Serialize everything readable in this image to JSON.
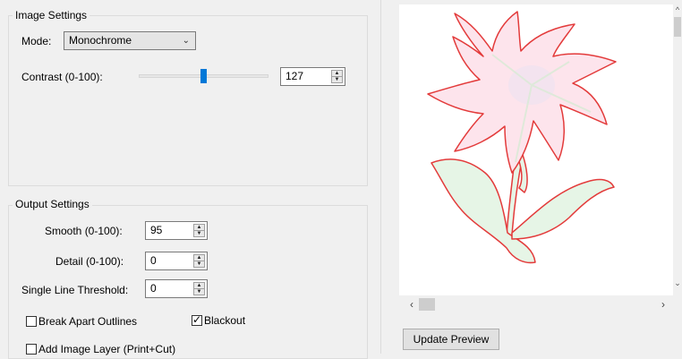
{
  "image_settings": {
    "title": "Image Settings",
    "mode_label": "Mode:",
    "mode_value": "Monochrome",
    "contrast_label": "Contrast (0-100):",
    "contrast_value": "127",
    "contrast_slider_fraction": 0.5
  },
  "output_settings": {
    "title": "Output Settings",
    "smooth_label": "Smooth (0-100):",
    "smooth_value": "95",
    "detail_label": "Detail (0-100):",
    "detail_value": "0",
    "threshold_label": "Single Line Threshold:",
    "threshold_value": "0",
    "break_apart_label": "Break Apart Outlines",
    "break_apart_checked": false,
    "blackout_label": "Blackout",
    "blackout_checked": true,
    "add_image_layer_label": "Add Image Layer (Print+Cut)",
    "add_image_layer_checked": false
  },
  "preview": {
    "update_button": "Update Preview",
    "fill_colors": {
      "petal": "#fde4ec",
      "leaf": "#e6f5e6",
      "center": "#f3e3ef",
      "outline": "#e33b3b"
    }
  },
  "icons": {
    "dropdown": "chevron-down-icon",
    "spin": "spin-arrows-icon",
    "scroll_left": "chevron-left-icon",
    "scroll_right": "chevron-right-icon",
    "scroll_up": "chevron-up-icon",
    "scroll_down": "chevron-down-icon",
    "check": "checkmark-icon"
  }
}
